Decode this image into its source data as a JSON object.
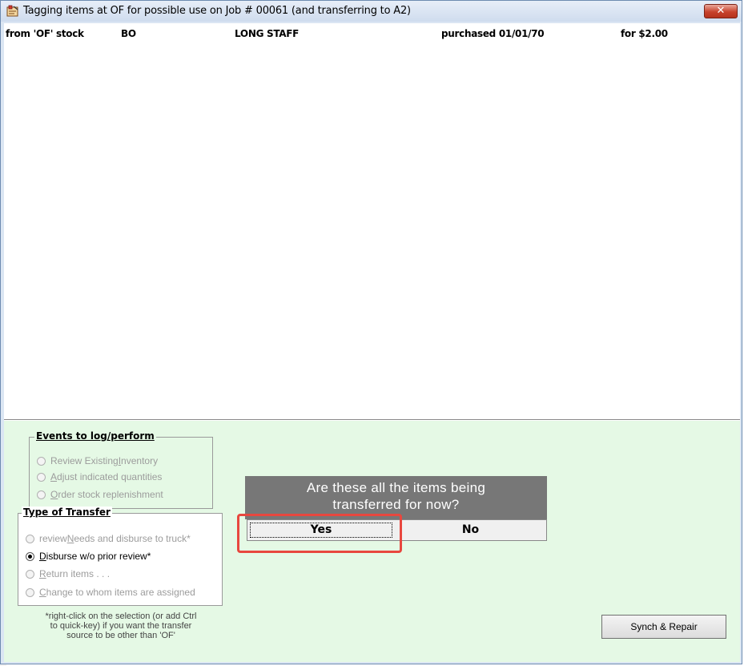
{
  "window": {
    "title": "Tagging items at OF for possible use on Job # 00061 (and transferring to A2)",
    "close_label": "✕",
    "accent_color": "#c7422c"
  },
  "list": {
    "rows": [
      {
        "source": "from 'OF' stock",
        "code": "BO",
        "description": "LONG STAFF",
        "purchased": "purchased 01/01/70",
        "price": "for  $2.00"
      }
    ]
  },
  "events_group": {
    "title": "Events to log/perform",
    "options": [
      {
        "pre": "Review Existing ",
        "key": "I",
        "post": "nventory",
        "enabled": false,
        "checked": false
      },
      {
        "pre": "",
        "key": "A",
        "post": "djust indicated quantities",
        "enabled": false,
        "checked": false
      },
      {
        "pre": "",
        "key": "O",
        "post": "rder stock replenishment",
        "enabled": false,
        "checked": false
      }
    ]
  },
  "transfer_group": {
    "title": "Type of Transfer",
    "options": [
      {
        "pre": "review ",
        "key": "N",
        "post": "eeds and disburse to truck*",
        "enabled": false,
        "checked": false
      },
      {
        "pre": "",
        "key": "D",
        "post": "isburse w/o prior review*",
        "enabled": true,
        "checked": true
      },
      {
        "pre": "",
        "key": "R",
        "post": "eturn items . . .",
        "enabled": false,
        "checked": false
      },
      {
        "pre": "",
        "key": "C",
        "post": "hange to whom items are assigned",
        "enabled": false,
        "checked": false
      }
    ]
  },
  "footnote": {
    "line1": "*right-click on the selection (or add Ctrl",
    "line2": "to quick-key) if you want the transfer",
    "line3": "source to be other than 'OF'"
  },
  "dialog": {
    "line1": "Are these all the items being",
    "line2": "transferred for now?",
    "yes_label": "Yes",
    "no_label": "No"
  },
  "buttons": {
    "synch_label": "Synch & Repair"
  }
}
